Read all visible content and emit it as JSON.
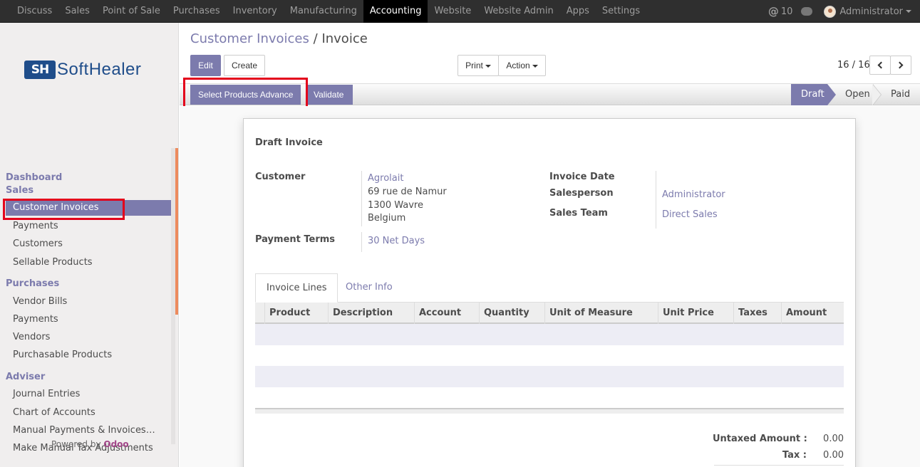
{
  "topbar": {
    "menu": [
      "Discuss",
      "Sales",
      "Point of Sale",
      "Purchases",
      "Inventory",
      "Manufacturing",
      "Accounting",
      "Website",
      "Website Admin",
      "Apps",
      "Settings"
    ],
    "active_index": 6,
    "notifications_count": "10",
    "user": "Administrator"
  },
  "sidebar": {
    "logo_mark": "SH",
    "logo_text": "SoftHealer",
    "sections": [
      {
        "title": "Dashboard"
      },
      {
        "title": "Sales",
        "items": [
          "Customer Invoices",
          "Payments",
          "Customers",
          "Sellable Products"
        ]
      },
      {
        "title": "Purchases",
        "items": [
          "Vendor Bills",
          "Payments",
          "Vendors",
          "Purchasable Products"
        ]
      },
      {
        "title": "Adviser",
        "items": [
          "Journal Entries",
          "Chart of Accounts",
          "Manual Payments & Invoices…",
          "Make Manual Tax Adjustments"
        ]
      }
    ],
    "powered_by": "Powered by",
    "powered_brand": "Odoo"
  },
  "control_panel": {
    "breadcrumb_parent": "Customer Invoices",
    "breadcrumb_sep": "/",
    "breadcrumb_current": "Invoice",
    "edit_label": "Edit",
    "create_label": "Create",
    "print_label": "Print",
    "action_label": "Action",
    "pager": "16 / 16"
  },
  "statusbar": {
    "select_products_label": "Select Products Advance",
    "validate_label": "Validate",
    "stages": [
      "Draft",
      "Open",
      "Paid"
    ],
    "current_stage": "Draft"
  },
  "invoice": {
    "title": "Draft Invoice",
    "customer_label": "Customer",
    "customer_name": "Agrolait",
    "customer_address": [
      "69 rue de Namur",
      "1300 Wavre",
      "Belgium"
    ],
    "payment_terms_label": "Payment Terms",
    "payment_terms": "30 Net Days",
    "invoice_date_label": "Invoice Date",
    "invoice_date": "",
    "salesperson_label": "Salesperson",
    "salesperson": "Administrator",
    "sales_team_label": "Sales Team",
    "sales_team": "Direct Sales"
  },
  "tabs": [
    "Invoice Lines",
    "Other Info"
  ],
  "lines_table": {
    "columns": [
      "Product",
      "Description",
      "Account",
      "Quantity",
      "Unit of Measure",
      "Unit Price",
      "Taxes",
      "Amount"
    ],
    "rows": []
  },
  "totals": {
    "untaxed_label": "Untaxed Amount :",
    "untaxed_value": "0.00",
    "tax_label": "Tax :",
    "tax_value": "0.00"
  },
  "colors": {
    "accent": "#7c7bad",
    "annotation": "#e3001b"
  }
}
